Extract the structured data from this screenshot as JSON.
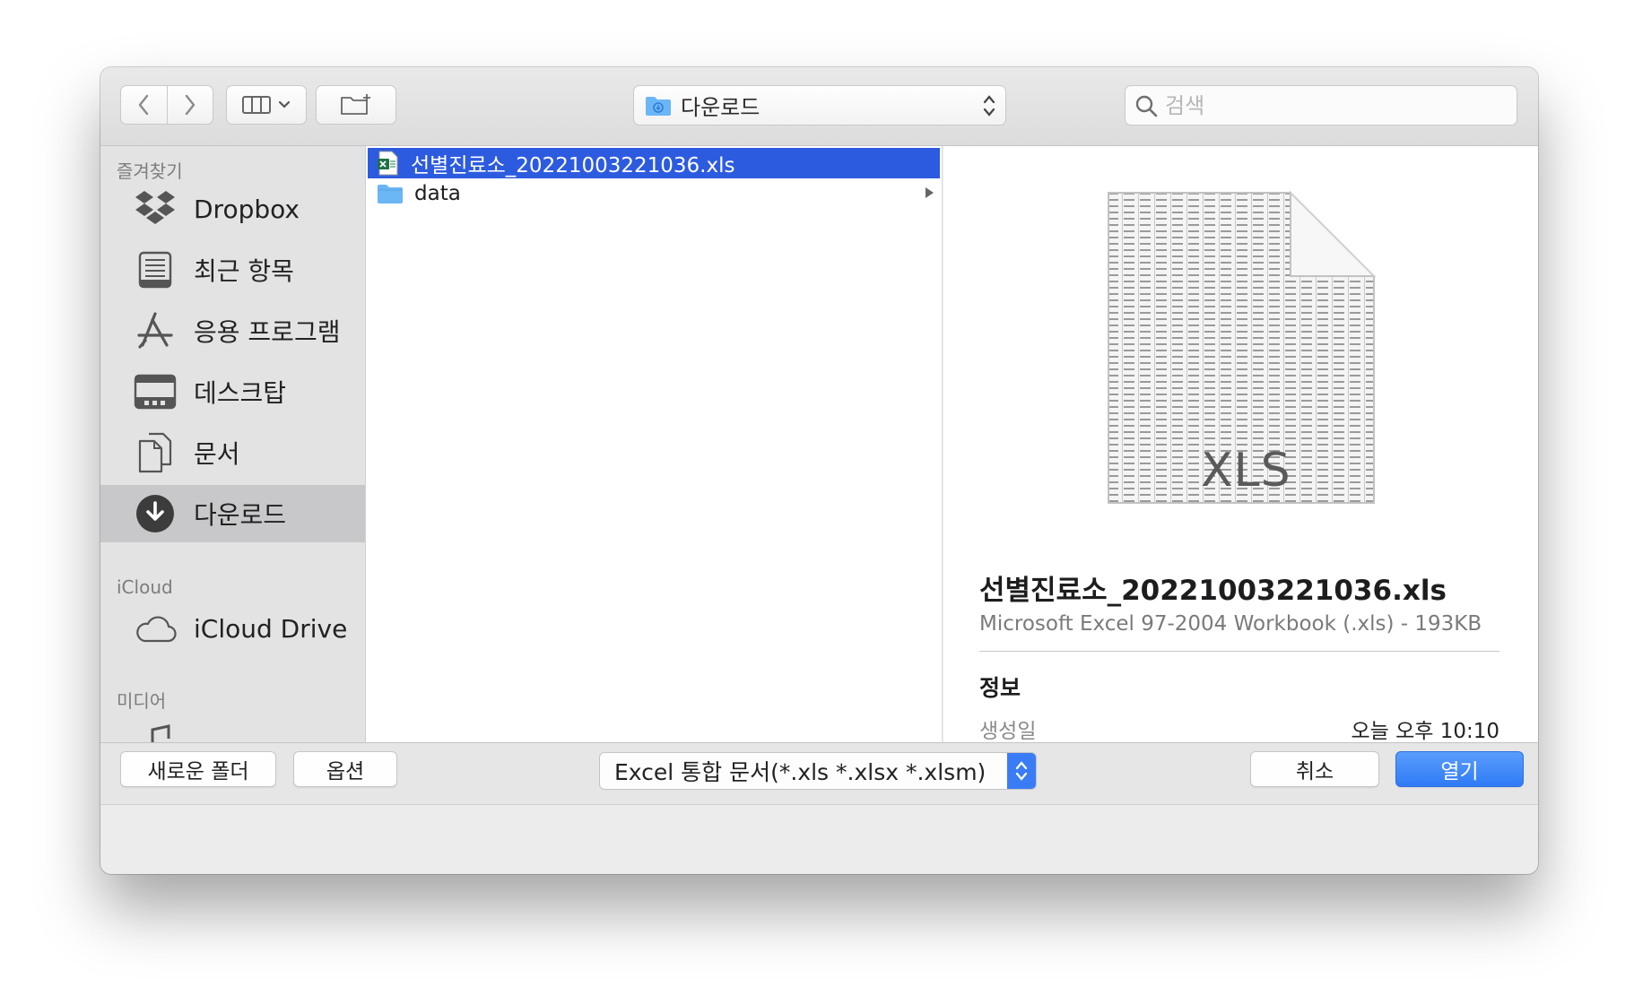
{
  "toolbar": {
    "path_label": "다운로드",
    "search_placeholder": "검색"
  },
  "sidebar": {
    "favorites_title": "즐겨찾기",
    "favorites": [
      {
        "label": "Dropbox",
        "icon": "dropbox-icon"
      },
      {
        "label": "최근 항목",
        "icon": "recents-icon"
      },
      {
        "label": "응용 프로그램",
        "icon": "applications-icon"
      },
      {
        "label": "데스크탑",
        "icon": "desktop-icon"
      },
      {
        "label": "문서",
        "icon": "documents-icon"
      },
      {
        "label": "다운로드",
        "icon": "downloads-icon",
        "selected": true
      }
    ],
    "icloud_title": "iCloud",
    "icloud_items": [
      {
        "label": "iCloud Drive",
        "icon": "icloud-icon"
      }
    ],
    "media_title": "미디어"
  },
  "files": [
    {
      "name": "선별진료소_20221003221036.xls",
      "icon": "excel-file-icon",
      "selected": true
    },
    {
      "name": "data",
      "icon": "folder-icon",
      "has_children": true
    }
  ],
  "preview": {
    "doc_badge": "XLS",
    "title": "선별진료소_20221003221036.xls",
    "subtitle": "Microsoft Excel 97-2004 Workbook (.xls) - 193KB",
    "info_heading": "정보",
    "created_label": "생성일",
    "created_value": "오늘 오후 10:10"
  },
  "filter": {
    "selected": "Excel 통합 문서(*.xls *.xlsx *.xlsm)"
  },
  "buttons": {
    "new_folder": "새로운 폴더",
    "options": "옵션",
    "cancel": "취소",
    "open": "열기"
  },
  "colors": {
    "accent": "#2f7bf6",
    "selection": "#2d5be0",
    "folder": "#6bb6f5"
  }
}
